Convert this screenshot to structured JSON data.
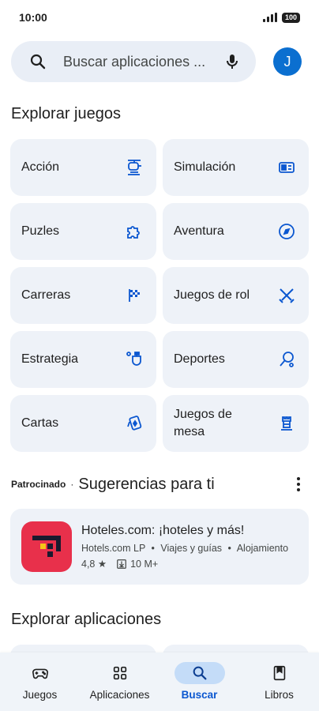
{
  "status_bar": {
    "time": "10:00",
    "battery": "100"
  },
  "search": {
    "placeholder": "Buscar aplicaciones ...",
    "avatar_initial": "J"
  },
  "explore_games": {
    "title": "Explorar juegos",
    "categories": [
      {
        "label": "Acción",
        "icon": "helicopter-icon"
      },
      {
        "label": "Simulación",
        "icon": "id-card-icon"
      },
      {
        "label": "Puzles",
        "icon": "puzzle-icon"
      },
      {
        "label": "Aventura",
        "icon": "compass-icon"
      },
      {
        "label": "Carreras",
        "icon": "checkered-flag-icon"
      },
      {
        "label": "Juegos de rol",
        "icon": "crossed-swords-icon"
      },
      {
        "label": "Estrategia",
        "icon": "shield-flag-icon"
      },
      {
        "label": "Deportes",
        "icon": "racket-icon"
      },
      {
        "label": "Cartas",
        "icon": "playing-card-icon"
      },
      {
        "label": "Juegos de mesa",
        "icon": "chess-rook-icon"
      }
    ]
  },
  "suggestions": {
    "sponsored_label": "Patrocinado",
    "separator": "·",
    "title": "Sugerencias para ti",
    "app": {
      "name": "Hoteles.com: ¡hoteles y más!",
      "developer": "Hotels.com LP",
      "category": "Viajes y guías",
      "subcategory": "Alojamiento",
      "meta_sep": "•",
      "rating": "4,8 ★",
      "downloads": "10 M+",
      "logo_color": "#e8304b"
    }
  },
  "explore_apps": {
    "title": "Explorar aplicaciones"
  },
  "bottom_nav": {
    "items": [
      {
        "label": "Juegos",
        "icon": "gamepad-icon"
      },
      {
        "label": "Aplicaciones",
        "icon": "apps-grid-icon"
      },
      {
        "label": "Buscar",
        "icon": "search-icon",
        "active": true
      },
      {
        "label": "Libros",
        "icon": "bookmark-icon"
      }
    ]
  },
  "colors": {
    "accent": "#0b57d0",
    "tile_bg": "#eef2f8",
    "search_bg": "#e9eef6",
    "nav_active": "#c4dcf8"
  }
}
